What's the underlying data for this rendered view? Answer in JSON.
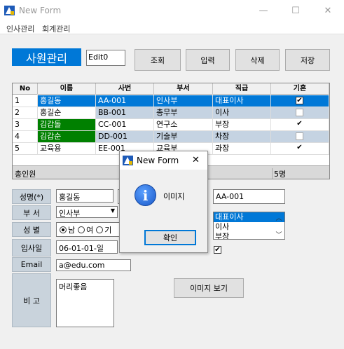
{
  "window": {
    "title": "New Form",
    "minimize": "—",
    "maximize": "☐",
    "close": "✕"
  },
  "menu": [
    "인사관리",
    "회계관리"
  ],
  "header": {
    "title": "사원관리",
    "edit_value": "Edit0"
  },
  "toolbar": {
    "search_label": "조회",
    "insert_label": "입력",
    "delete_label": "삭제",
    "save_label": "저장"
  },
  "grid": {
    "columns": [
      "No",
      "이름",
      "사번",
      "부서",
      "직급",
      "기혼"
    ],
    "rows": [
      {
        "no": "1",
        "name": "홍길동",
        "id": "AA-001",
        "dept": "인사부",
        "rank": "대표이사",
        "married": true
      },
      {
        "no": "2",
        "name": "홍길순",
        "id": "BB-001",
        "dept": "총무부",
        "rank": "이사",
        "married": false
      },
      {
        "no": "3",
        "name": "김갑돌",
        "id": "CC-001",
        "dept": "연구소",
        "rank": "부장",
        "married": true
      },
      {
        "no": "4",
        "name": "김갑순",
        "id": "DD-001",
        "dept": "기술부",
        "rank": "차장",
        "married": false
      },
      {
        "no": "5",
        "name": "교육용",
        "id": "EE-001",
        "dept": "교육부",
        "rank": "과장",
        "married": true
      }
    ],
    "footer_label": "총인원",
    "footer_count": "5명"
  },
  "form": {
    "name_label": "성명(*)",
    "name_value": "홍길동",
    "dept_label": "부 서",
    "dept_value": "인사부",
    "gender_label": "성 별",
    "gender_male": "남",
    "gender_female": "여",
    "gender_other": "기",
    "hire_label": "입사일",
    "hire_value": "06-01-01-일",
    "email_label": "Email",
    "email_value": "a@edu.com",
    "note_label": "비 고",
    "note_value": "머리좋음",
    "id_value": "AA-001",
    "rank_options": [
      "대표이사",
      "이사",
      "부장"
    ],
    "view_image_label": "이미지 보기"
  },
  "dialog": {
    "title": "New Form",
    "message": "이미지",
    "ok_label": "확인",
    "close": "✕"
  },
  "colors": {
    "accent": "#0078d7",
    "selected_row": "#0078d7",
    "alt_row": "#c5d3e2",
    "green_cell": "#008000"
  }
}
